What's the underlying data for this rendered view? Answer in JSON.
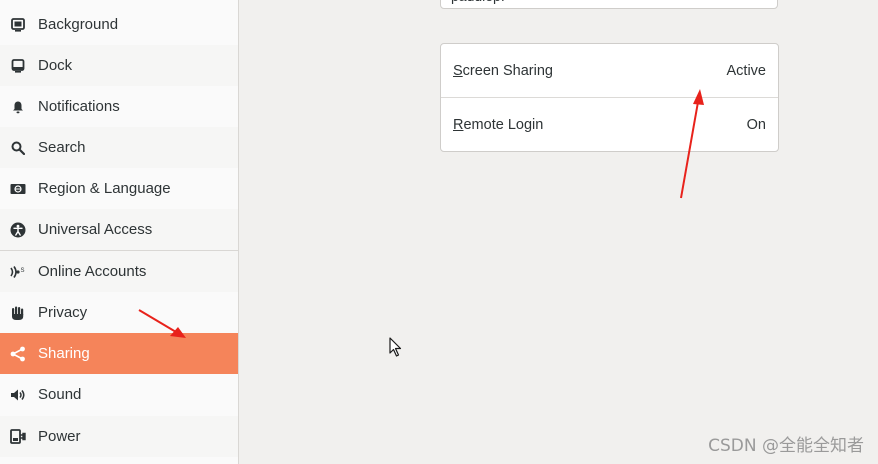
{
  "sidebar": {
    "items": [
      {
        "label": "Background",
        "icon": "background-icon"
      },
      {
        "label": "Dock",
        "icon": "dock-icon"
      },
      {
        "label": "Notifications",
        "icon": "bell-icon"
      },
      {
        "label": "Search",
        "icon": "search-icon"
      },
      {
        "label": "Region & Language",
        "icon": "region-icon"
      },
      {
        "label": "Universal Access",
        "icon": "accessibility-icon"
      },
      {
        "label": "Online Accounts",
        "icon": "online-accounts-icon"
      },
      {
        "label": "Privacy",
        "icon": "hand-icon"
      },
      {
        "label": "Sharing",
        "icon": "share-icon"
      },
      {
        "label": "Sound",
        "icon": "speaker-icon"
      },
      {
        "label": "Power",
        "icon": "power-plug-icon"
      }
    ],
    "active_item": "Sharing"
  },
  "main": {
    "device_name_field": {
      "value": "paddlep."
    },
    "rows": [
      {
        "label": "Screen Sharing",
        "mnemonic": "S",
        "rest": "creen Sharing",
        "status": "Active"
      },
      {
        "label": "Remote Login",
        "mnemonic": "R",
        "rest": "emote Login",
        "status": "On"
      }
    ]
  },
  "watermark": "CSDN @全能全知者",
  "colors": {
    "accent": "#f5845a",
    "annotation_arrow": "#e8221b"
  }
}
